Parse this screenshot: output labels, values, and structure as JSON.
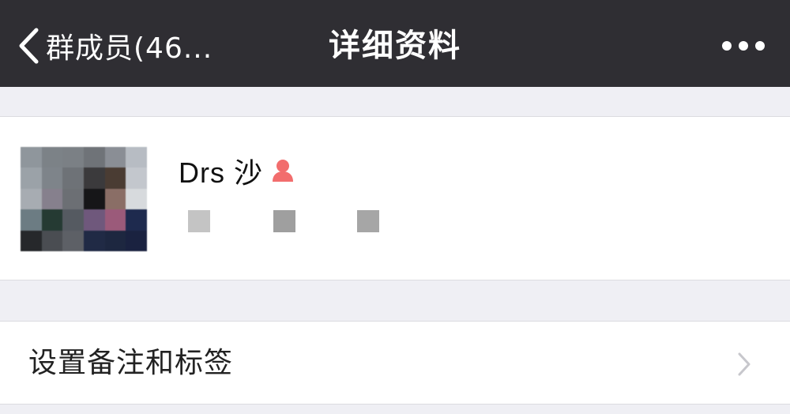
{
  "navbar": {
    "back_label": "群成员(46...",
    "title": "详细资料",
    "more_icon": "more-dots-icon",
    "back_icon": "chevron-left-icon",
    "background": "#2f2e33"
  },
  "profile": {
    "display_name": "Drs  沙",
    "gender_icon": "female-icon",
    "gender_color": "#f26d6d",
    "avatar_mosaic": [
      "#8f969c",
      "#7c8287",
      "#7b8085",
      "#6f7378",
      "#8a8e95",
      "#b7bcc3",
      "#9ba2a8",
      "#7e848a",
      "#6e7277",
      "#3b3a3c",
      "#4a3c33",
      "#c3c7cd",
      "#a7acb2",
      "#86808d",
      "#6c6f74",
      "#161618",
      "#8a6e66",
      "#d7dadd",
      "#6c7c83",
      "#253a33",
      "#555a61",
      "#6f587c",
      "#9b5a7a",
      "#1e2a4e",
      "#26282b",
      "#4a4d52",
      "#5d6066",
      "#202a45",
      "#1d2740",
      "#1a2240"
    ]
  },
  "settings": {
    "remark_label": "设置备注和标签",
    "chevron_icon": "chevron-right-icon"
  }
}
